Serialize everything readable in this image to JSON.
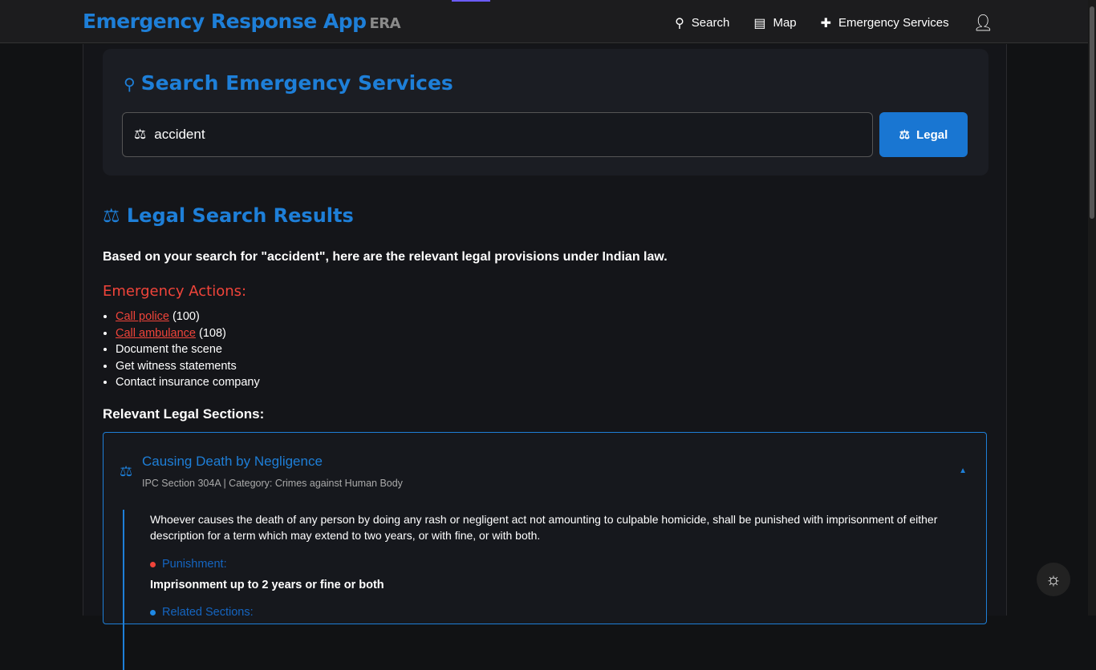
{
  "header": {
    "title": "Emergency Response App",
    "abbr": "ERA",
    "nav": [
      {
        "label": "Search",
        "icon": "search-icon"
      },
      {
        "label": "Map",
        "icon": "map-icon"
      },
      {
        "label": "Emergency Services",
        "icon": "medical-plus-icon"
      }
    ]
  },
  "search": {
    "title": "Search Emergency Services",
    "value": "accident",
    "button": "Legal"
  },
  "results": {
    "title": "Legal Search Results",
    "intro": "Based on your search for \"accident\", here are the relevant legal provisions under Indian law.",
    "actions_title": "Emergency Actions:",
    "actions": [
      {
        "link": "Call police",
        "extra": "(100)"
      },
      {
        "link": "Call ambulance",
        "extra": "(108)"
      },
      {
        "text": "Document the scene"
      },
      {
        "text": "Get witness statements"
      },
      {
        "text": "Contact insurance company"
      }
    ],
    "sections_title": "Relevant Legal Sections:",
    "sections": [
      {
        "title": "Causing Death by Negligence",
        "meta": "IPC Section 304A | Category: Crimes against Human Body",
        "description": "Whoever causes the death of any person by doing any rash or negligent act not amounting to culpable homicide, shall be punished with imprisonment of either description for a term which may extend to two years, or with fine, or with both.",
        "punishment_label": "Punishment:",
        "punishment": "Imprisonment up to 2 years or fine or both",
        "related_label": "Related Sections:"
      }
    ]
  },
  "colors": {
    "accent": "#1e7fd8",
    "danger": "#f0443a"
  }
}
